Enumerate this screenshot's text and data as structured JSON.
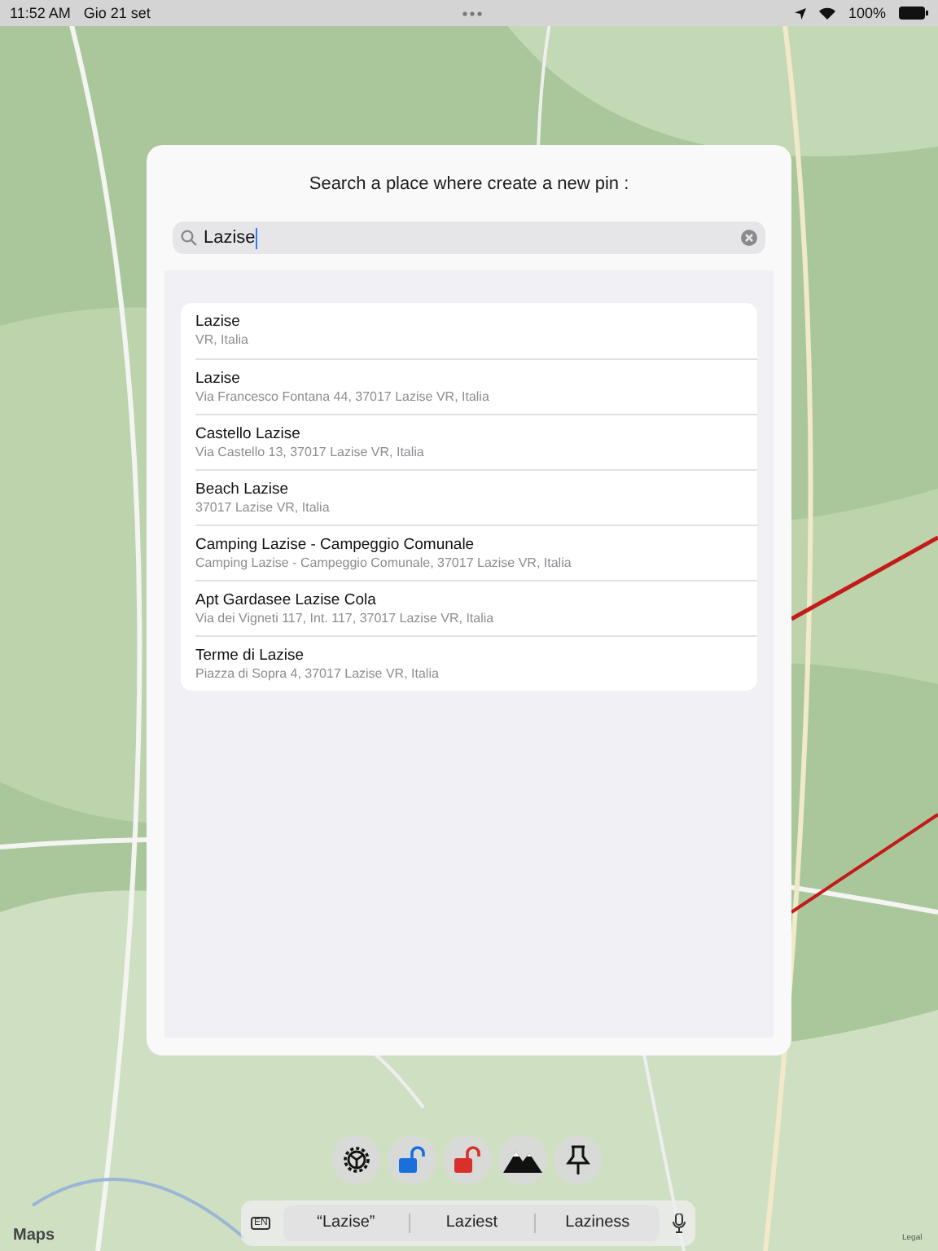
{
  "status_bar": {
    "time": "11:52 AM",
    "date": "Gio 21 set",
    "battery": "100%"
  },
  "map": {
    "logo": "Maps",
    "legal": "Legal"
  },
  "dialog": {
    "title": "Search a place where create a new pin :",
    "search": {
      "value": "Lazise"
    },
    "results": [
      {
        "name": "Lazise",
        "address": "VR, Italia"
      },
      {
        "name": "Lazise",
        "address": "Via Francesco Fontana 44, 37017 Lazise VR, Italia"
      },
      {
        "name": "Castello Lazise",
        "address": "Via Castello 13, 37017 Lazise VR, Italia"
      },
      {
        "name": "Beach Lazise",
        "address": "37017 Lazise VR, Italia"
      },
      {
        "name": "Camping Lazise - Campeggio Comunale",
        "address": "Camping Lazise - Campeggio Comunale, 37017 Lazise VR, Italia"
      },
      {
        "name": "Apt Gardasee Lazise Cola",
        "address": "Via dei Vigneti 117, Int. 117, 37017 Lazise VR, Italia"
      },
      {
        "name": "Terme di Lazise",
        "address": "Piazza di Sopra 4, 37017 Lazise VR, Italia"
      }
    ]
  },
  "toolbar": [
    {
      "kind": "settings"
    },
    {
      "kind": "unlock",
      "color": "#1a6fdc"
    },
    {
      "kind": "unlock",
      "color": "#d9302c"
    },
    {
      "kind": "mountains"
    },
    {
      "kind": "pin"
    }
  ],
  "keyboard_bar": {
    "language": "EN",
    "suggestions": [
      "“Lazise”",
      "Laziest",
      "Laziness"
    ]
  }
}
